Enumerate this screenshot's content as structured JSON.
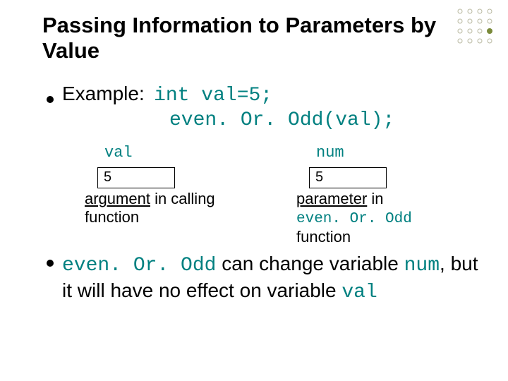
{
  "title": "Passing Information to Parameters by Value",
  "example": {
    "label": "Example:",
    "code1": "int val=5;",
    "code2": "even. Or. Odd(val);"
  },
  "diagram": {
    "left": {
      "var": "val",
      "value": "5",
      "caption_underlined": "argument",
      "caption_rest": " in calling function"
    },
    "right": {
      "var": "num",
      "value": "5",
      "caption_underlined": "parameter",
      "caption_rest_before_code": " in ",
      "caption_code": "even. Or. Odd",
      "caption_after_code": " function"
    }
  },
  "body": {
    "code1": "even. Or. Odd",
    "text1": " can change variable ",
    "code2": "num",
    "text2": ", but it will have no effect on variable ",
    "code3": "val"
  }
}
